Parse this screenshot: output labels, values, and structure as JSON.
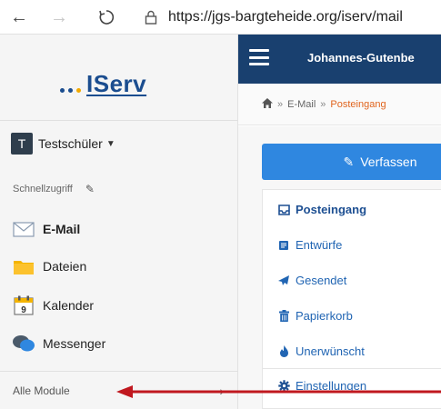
{
  "browser": {
    "url": "https://jgs-bargteheide.org/iserv/mail"
  },
  "sidebar": {
    "logo_text": "IServ",
    "user_initial": "T",
    "user_name": "Testschüler",
    "quick_access_label": "Schnellzugriff",
    "modules": [
      {
        "label": "E-Mail",
        "icon": "envelope-icon",
        "active": true
      },
      {
        "label": "Dateien",
        "icon": "folder-icon",
        "active": false
      },
      {
        "label": "Kalender",
        "icon": "calendar-icon",
        "active": false
      },
      {
        "label": "Messenger",
        "icon": "chat-icon",
        "active": false
      }
    ],
    "all_modules_label": "Alle Module",
    "calendar_day": "9"
  },
  "header": {
    "title": "Johannes-Gutenbe"
  },
  "breadcrumb": {
    "items": [
      "E-Mail",
      "Posteingang"
    ]
  },
  "mail": {
    "compose_label": "Verfassen",
    "folders": [
      {
        "label": "Posteingang",
        "icon": "inbox-icon",
        "active": true
      },
      {
        "label": "Entwürfe",
        "icon": "drafts-icon",
        "active": false
      },
      {
        "label": "Gesendet",
        "icon": "sent-icon",
        "active": false
      },
      {
        "label": "Papierkorb",
        "icon": "trash-icon",
        "active": false
      },
      {
        "label": "Unerwünscht",
        "icon": "spam-icon",
        "active": false
      }
    ],
    "settings_label": "Einstellungen"
  },
  "colors": {
    "brand_blue": "#19406f",
    "accent_blue": "#2f87e0",
    "breadcrumb_active": "#e0641e",
    "annotation_arrow": "#c0181f"
  }
}
